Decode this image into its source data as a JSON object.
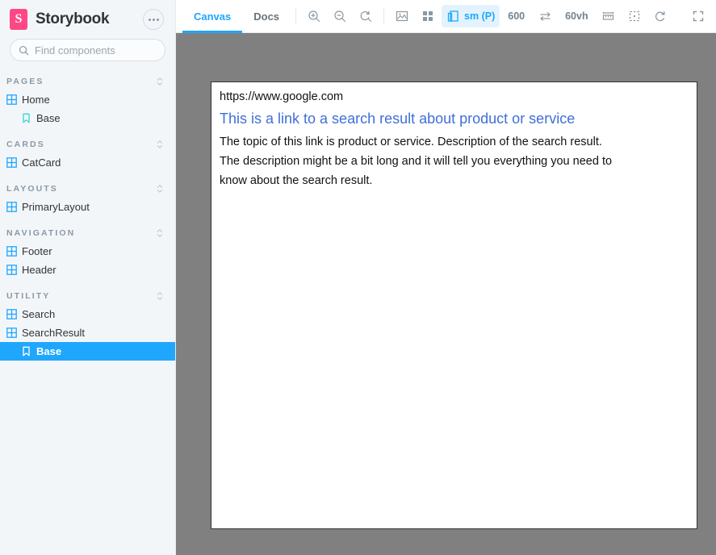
{
  "sidebar": {
    "brand": {
      "logo_letter": "S",
      "name": "Storybook",
      "menu_icon": "ellipsis-icon"
    },
    "search": {
      "placeholder": "Find components",
      "value": "",
      "shortcut": "/"
    },
    "sections": [
      {
        "label": "PAGES",
        "items": [
          {
            "label": "Home",
            "type": "component",
            "selected": false
          },
          {
            "label": "Base",
            "type": "story",
            "selected": false
          }
        ]
      },
      {
        "label": "CARDS",
        "items": [
          {
            "label": "CatCard",
            "type": "component",
            "selected": false
          }
        ]
      },
      {
        "label": "LAYOUTS",
        "items": [
          {
            "label": "PrimaryLayout",
            "type": "component",
            "selected": false
          }
        ]
      },
      {
        "label": "NAVIGATION",
        "items": [
          {
            "label": "Footer",
            "type": "component",
            "selected": false
          },
          {
            "label": "Header",
            "type": "component",
            "selected": false
          }
        ]
      },
      {
        "label": "UTILITY",
        "items": [
          {
            "label": "Search",
            "type": "component",
            "selected": false
          },
          {
            "label": "SearchResult",
            "type": "component",
            "selected": false
          },
          {
            "label": "Base",
            "type": "story",
            "selected": true
          }
        ]
      }
    ]
  },
  "toolbar": {
    "tabs": [
      {
        "label": "Canvas",
        "active": true
      },
      {
        "label": "Docs",
        "active": false
      }
    ],
    "zoom_in": "zoom-in-icon",
    "zoom_out": "zoom-out-icon",
    "zoom_reset": "zoom-reset-icon",
    "backgrounds": "backgrounds-image-icon",
    "grid": "grid-icon",
    "viewport_icon": "viewport-icon",
    "viewport_label": "sm (P)",
    "width_value": "600",
    "swap_icon": "swap-arrows-icon",
    "height_value": "60vh",
    "measure": "measure-ruler-icon",
    "outline": "outline-dashed-box-icon",
    "remount": "refresh-icon",
    "fullscreen": "fullscreen-expand-icon"
  },
  "canvas": {
    "story": {
      "url": "https://www.google.com",
      "title": "This is a link to a search result about product or service",
      "description": "The topic of this link is product or service. Description of the search result. The description might be a bit long and it will tell you everything you need to know about the search result."
    }
  },
  "colors": {
    "accent": "#1EA7FD",
    "brand_pink": "#FF4785",
    "link_blue": "#3F6FD8",
    "sidebar_bg": "#F3F6F9",
    "canvas_bg": "#808080"
  }
}
